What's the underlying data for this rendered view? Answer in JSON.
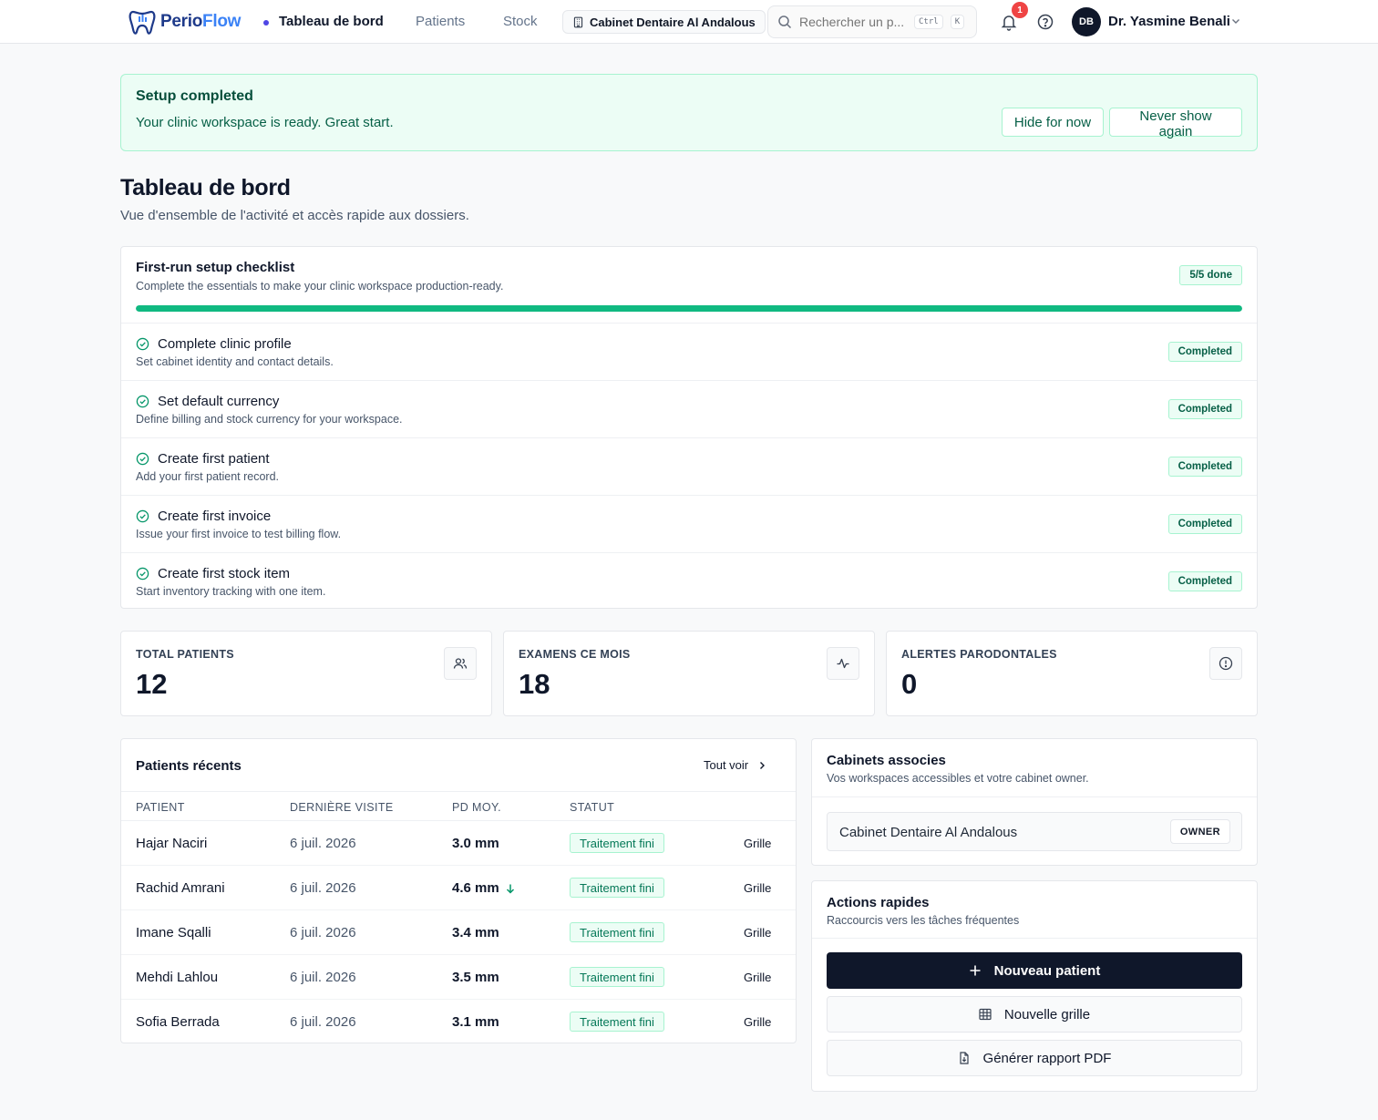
{
  "app": {
    "logo_part1": "Perio",
    "logo_part2": "Flow"
  },
  "nav": {
    "items": [
      {
        "label": "Tableau de bord",
        "active": true
      },
      {
        "label": "Patients",
        "active": false
      },
      {
        "label": "Stock",
        "active": false
      }
    ],
    "clinic_selector": "Cabinet Dentaire Al Andalous",
    "search_placeholder": "Rechercher un p...",
    "search_kbd_1": "Ctrl",
    "search_kbd_2": "K",
    "notification_count": "1",
    "user_initials": "DB",
    "user_name": "Dr. Yasmine Benali"
  },
  "banner": {
    "title": "Setup completed",
    "text": "Your clinic workspace is ready. Great start.",
    "hide_label": "Hide for now",
    "never_label": "Never show again"
  },
  "page": {
    "title": "Tableau de bord",
    "subtitle": "Vue d'ensemble de l'activité et accès rapide aux dossiers."
  },
  "checklist": {
    "title": "First-run setup checklist",
    "subtitle": "Complete the essentials to make your clinic workspace production-ready.",
    "progress_label": "5/5 done",
    "progress_fraction": 1.0,
    "items": [
      {
        "label": "Complete clinic profile",
        "desc": "Set cabinet identity and contact details.",
        "status": "Completed"
      },
      {
        "label": "Set default currency",
        "desc": "Define billing and stock currency for your workspace.",
        "status": "Completed"
      },
      {
        "label": "Create first patient",
        "desc": "Add your first patient record.",
        "status": "Completed"
      },
      {
        "label": "Create first invoice",
        "desc": "Issue your first invoice to test billing flow.",
        "status": "Completed"
      },
      {
        "label": "Create first stock item",
        "desc": "Start inventory tracking with one item.",
        "status": "Completed"
      }
    ]
  },
  "stats": [
    {
      "label": "TOTAL PATIENTS",
      "value": "12",
      "icon": "users-icon"
    },
    {
      "label": "EXAMENS CE MOIS",
      "value": "18",
      "icon": "activity-icon"
    },
    {
      "label": "ALERTES PARODONTALES",
      "value": "0",
      "icon": "alert-circle-icon"
    }
  ],
  "recent": {
    "title": "Patients récents",
    "see_all": "Tout voir",
    "columns": [
      "PATIENT",
      "DERNIÈRE VISITE",
      "PD MOY.",
      "STATUT"
    ],
    "rows": [
      {
        "name": "Hajar Naciri",
        "date": "6 juil. 2026",
        "pd": "3.0 mm",
        "trend_down": false,
        "status": "Traitement fini",
        "action": "Grille"
      },
      {
        "name": "Rachid Amrani",
        "date": "6 juil. 2026",
        "pd": "4.6 mm",
        "trend_down": true,
        "status": "Traitement fini",
        "action": "Grille"
      },
      {
        "name": "Imane Sqalli",
        "date": "6 juil. 2026",
        "pd": "3.4 mm",
        "trend_down": false,
        "status": "Traitement fini",
        "action": "Grille"
      },
      {
        "name": "Mehdi Lahlou",
        "date": "6 juil. 2026",
        "pd": "3.5 mm",
        "trend_down": false,
        "status": "Traitement fini",
        "action": "Grille"
      },
      {
        "name": "Sofia Berrada",
        "date": "6 juil. 2026",
        "pd": "3.1 mm",
        "trend_down": false,
        "status": "Traitement fini",
        "action": "Grille"
      }
    ]
  },
  "assoc": {
    "title": "Cabinets associes",
    "subtitle": "Vos workspaces accessibles et votre cabinet owner.",
    "clinic_name": "Cabinet Dentaire Al Andalous",
    "role": "OWNER"
  },
  "actions": {
    "title": "Actions rapides",
    "subtitle": "Raccourcis vers les tâches fréquentes",
    "new_patient": "Nouveau patient",
    "new_grid": "Nouvelle grille",
    "pdf_report": "Générer rapport PDF"
  },
  "colors": {
    "accent": "#4f46e5",
    "success": "#10b981",
    "primary_dark": "#0f172a",
    "danger": "#ef4444"
  }
}
